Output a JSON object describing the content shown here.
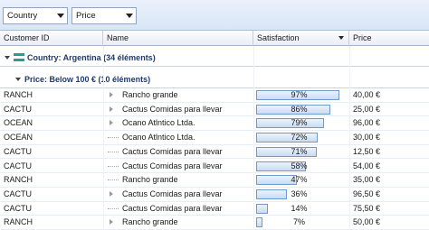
{
  "group_panel": {
    "chips": [
      {
        "label": "Country"
      },
      {
        "label": "Price"
      }
    ]
  },
  "columns": [
    {
      "label": "Customer ID"
    },
    {
      "label": "Name"
    },
    {
      "label": "Satisfaction"
    },
    {
      "label": "Price"
    }
  ],
  "groups": {
    "country": "Country: Argentina (34 éléments)",
    "price": "Price: Below 100 € (10 éléments)"
  },
  "rows": [
    {
      "id": "RANCH",
      "name": "Rancho grande",
      "expander": "tri",
      "satisfaction": "97%",
      "sat_value": 0.97,
      "price": "40,00 €"
    },
    {
      "id": "CACTU",
      "name": "Cactus Comidas para llevar",
      "expander": "tri",
      "satisfaction": "86%",
      "sat_value": 0.86,
      "price": "25,00 €"
    },
    {
      "id": "OCEAN",
      "name": "Ocano Atlntico Ltda.",
      "expander": "tri",
      "satisfaction": "79%",
      "sat_value": 0.79,
      "price": "96,00 €"
    },
    {
      "id": "OCEAN",
      "name": "Ocano Atlntico Ltda.",
      "expander": "line",
      "satisfaction": "72%",
      "sat_value": 0.72,
      "price": "30,00 €"
    },
    {
      "id": "CACTU",
      "name": "Cactus Comidas para llevar",
      "expander": "line",
      "satisfaction": "71%",
      "sat_value": 0.71,
      "price": "12,50 €"
    },
    {
      "id": "CACTU",
      "name": "Cactus Comidas para llevar",
      "expander": "line",
      "satisfaction": "58%",
      "sat_value": 0.58,
      "price": "54,00 €"
    },
    {
      "id": "RANCH",
      "name": "Rancho grande",
      "expander": "line",
      "satisfaction": "47%",
      "sat_value": 0.47,
      "price": "35,00 €"
    },
    {
      "id": "CACTU",
      "name": "Cactus Comidas para llevar",
      "expander": "tri",
      "satisfaction": "36%",
      "sat_value": 0.36,
      "price": "96,50 €"
    },
    {
      "id": "CACTU",
      "name": "Cactus Comidas para llevar",
      "expander": "line",
      "satisfaction": "14%",
      "sat_value": 0.14,
      "price": "75,50 €"
    },
    {
      "id": "RANCH",
      "name": "Rancho grande",
      "expander": "tri",
      "satisfaction": "7%",
      "sat_value": 0.07,
      "price": "50,00 €"
    }
  ],
  "colors": {
    "accent": "#1f3b6b",
    "bar_border": "#6f9acb",
    "country_icon": [
      "#2a9d8f",
      "#ffffff",
      "#2a9d8f"
    ]
  }
}
